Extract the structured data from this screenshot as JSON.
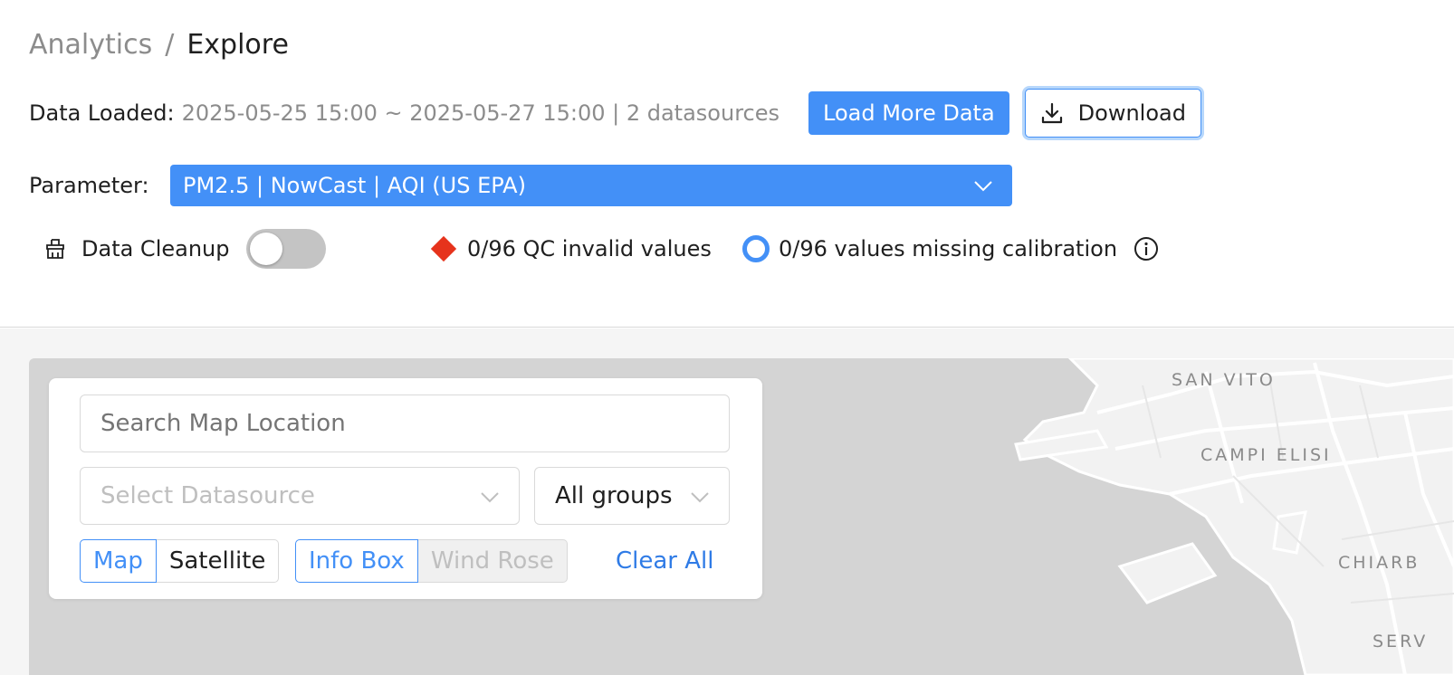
{
  "breadcrumb": {
    "parent": "Analytics",
    "separator": "/",
    "current": "Explore"
  },
  "data_loaded": {
    "label": "Data Loaded:",
    "value": "2025-05-25 15:00 ~ 2025-05-27 15:00 | 2 datasources",
    "load_more_label": "Load More Data",
    "download_label": "Download"
  },
  "parameter": {
    "label": "Parameter:",
    "selected": "PM2.5 | NowCast | AQI (US EPA)"
  },
  "cleanup": {
    "label": "Data Cleanup",
    "enabled": false,
    "qc_text": "0/96 QC invalid values",
    "calibration_text": "0/96 values missing calibration"
  },
  "map_panel": {
    "search_placeholder": "Search Map Location",
    "datasource_placeholder": "Select Datasource",
    "groups_value": "All groups",
    "view_options": [
      "Map",
      "Satellite"
    ],
    "view_selected": "Map",
    "layer_options": [
      "Info Box",
      "Wind Rose"
    ],
    "layer_selected": "Info Box",
    "clear_all_label": "Clear All"
  },
  "map_labels": [
    "SAN VITO",
    "CAMPI ELISI",
    "CHIARB",
    "SERV"
  ],
  "colors": {
    "accent": "#4390f7",
    "qc_marker": "#e6331c",
    "map_water": "#d4d4d4",
    "map_land": "#f2f2f2"
  },
  "icons": [
    "download-icon",
    "chevron-down-icon",
    "broom-icon",
    "info-icon"
  ]
}
